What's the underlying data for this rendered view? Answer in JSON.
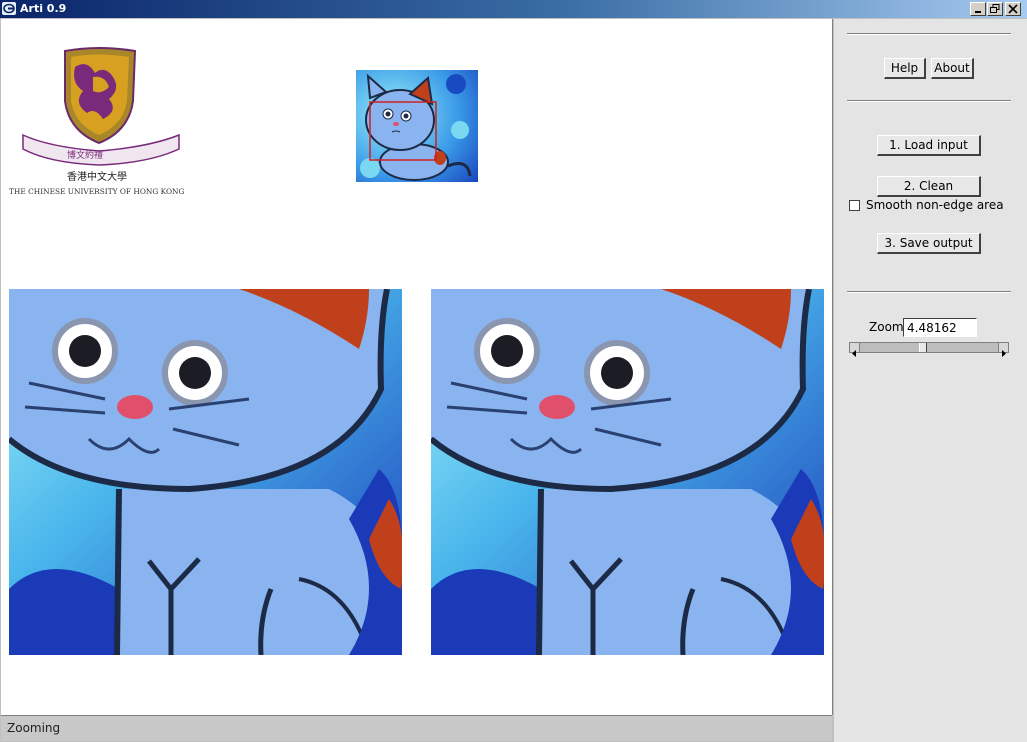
{
  "window": {
    "title": "Arti 0.9",
    "controls": [
      "minimize",
      "maximize",
      "close"
    ]
  },
  "logo": {
    "caption": "THE CHINESE UNIVERSITY OF HONG KONG",
    "chinese_name": "香港中文大學",
    "motto": "博文約禮"
  },
  "sidebar": {
    "help_label": "Help",
    "about_label": "About",
    "load_label": "1. Load input",
    "clean_label": "2. Clean",
    "smooth_label": "Smooth non-edge area",
    "smooth_checked": false,
    "save_label": "3. Save output",
    "zoom_label": "Zoom",
    "zoom_value": "4.48162",
    "zoom_slider_fraction": 0.45
  },
  "status": {
    "text": "Zooming"
  },
  "colors": {
    "cat_body": "#8ab4f0",
    "ear_patch": "#c0401c",
    "background_blue": "#2a6ad0",
    "background_cyan": "#5ce6f0",
    "outline": "#1c2a46",
    "nose": "#e0506a",
    "selection_rect": "#d02020"
  }
}
